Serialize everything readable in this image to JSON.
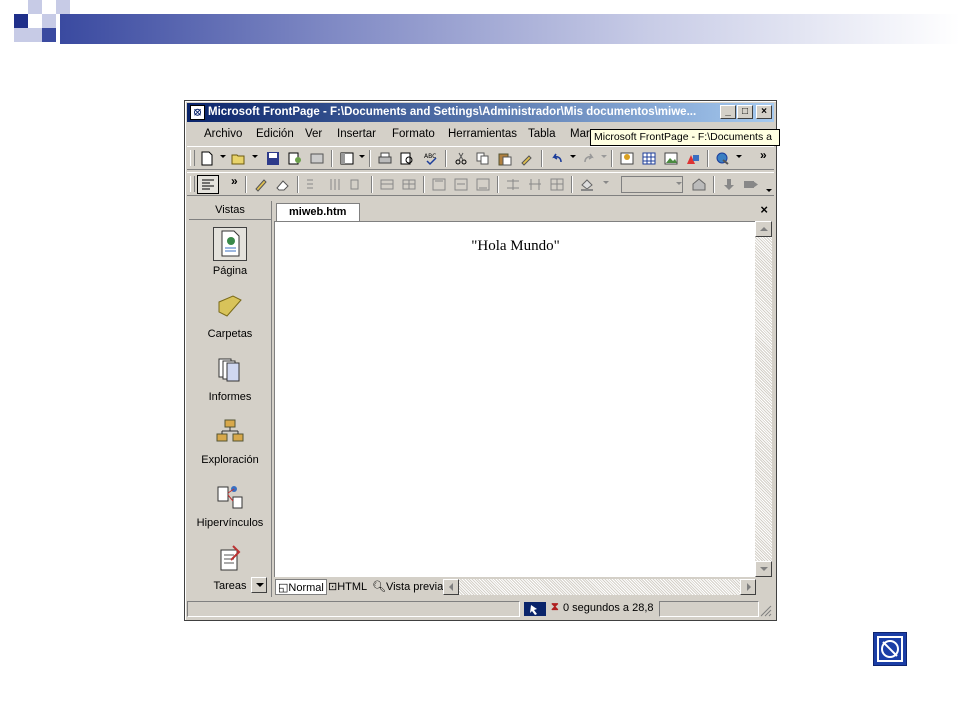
{
  "window": {
    "title": "Microsoft FrontPage - F:\\Documents and Settings\\Administrador\\Mis documentos\\miwe...",
    "tooltip": "Microsoft FrontPage - F:\\Documents a"
  },
  "menu": [
    "Archivo",
    "Edición",
    "Ver",
    "Insertar",
    "Formato",
    "Herramientas",
    "Tabla",
    "Marc"
  ],
  "views_bar": {
    "header": "Vistas",
    "items": [
      "Página",
      "Carpetas",
      "Informes",
      "Exploración",
      "Hipervínculos",
      "Tareas"
    ],
    "selected": "Página"
  },
  "document": {
    "tab_label": "miweb.htm",
    "content": "\"Hola Mundo\""
  },
  "view_tabs": [
    "Normal",
    "HTML",
    "Vista previa"
  ],
  "status": {
    "download_time": "0 segundos a 28,8"
  },
  "colors": {
    "title_start": "#0a246a",
    "title_end": "#a6caf0",
    "face": "#d4d0c8",
    "slide_accent": "#3a4aa0"
  }
}
